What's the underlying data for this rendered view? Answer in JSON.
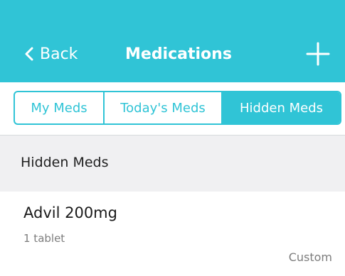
{
  "navbar": {
    "back_label": "Back",
    "title": "Medications",
    "back_icon": "chevron-left-icon",
    "add_icon": "plus-icon",
    "color": "#30c4d6"
  },
  "tabs": [
    {
      "label": "My Meds",
      "selected": false
    },
    {
      "label": "Today's Meds",
      "selected": false
    },
    {
      "label": "Hidden Meds",
      "selected": true
    }
  ],
  "section": {
    "header": "Hidden Meds"
  },
  "meds": [
    {
      "name": "Advil 200mg",
      "dose": "1 tablet",
      "schedule": "Custom"
    }
  ]
}
